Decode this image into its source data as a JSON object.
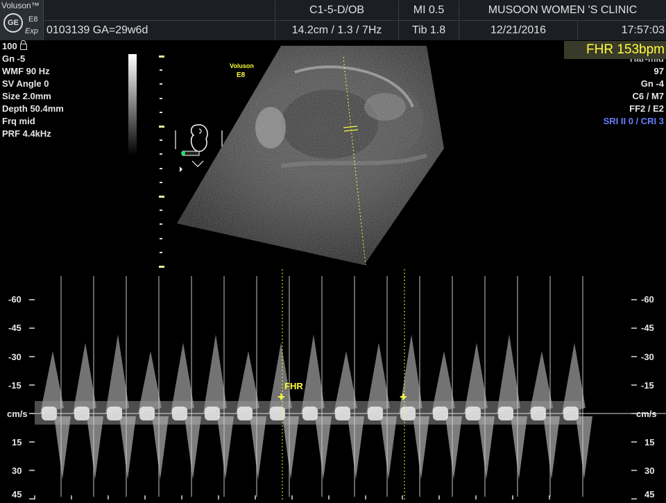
{
  "header": {
    "logo": {
      "title": "Voluson™",
      "brand": "GE",
      "model": "E8",
      "sub": "Exp"
    },
    "probe": "C1-5-D/OB",
    "mi": "MI  0.5",
    "clinic": "MUSOON WOMEN 'S CLINIC",
    "patient": "0103139  GA=29w6d",
    "settings": "14.2cm / 1.3 /  7Hz",
    "tib": "Tib  1.8",
    "date": "12/21/2016",
    "time": "17:57:03"
  },
  "left_params": {
    "power": "100",
    "gn": "Gn  -5",
    "wmf": "WMF 90 Hz",
    "sv_angle": "SV Angle  0",
    "size": "Size  2.0mm",
    "depth": "Depth 50.4mm",
    "frq": "Frq mid",
    "prf": "PRF  4.4kHz"
  },
  "right_params": {
    "fhr_badge": "FHR 153bpm",
    "har": "Har-mid",
    "val97": "97",
    "gn": "Gn  -4",
    "c6m7": "C6 / M7",
    "ff2e2": "FF2 / E2",
    "sri": "SRI II 0 / CRI 3"
  },
  "bmode": {
    "label_top": "Voluson",
    "label_bottom": "E8"
  },
  "doppler": {
    "unit": "cm/s",
    "scale_labels": [
      "-60",
      "-45",
      "-30",
      "-15",
      "cm/s",
      "15",
      "30",
      "45"
    ],
    "fhr_label": "FHR"
  },
  "colors": {
    "accent_yellow": "#ffff3c",
    "sri_blue": "#6b7cff",
    "header_bg": "#1b1f24"
  }
}
